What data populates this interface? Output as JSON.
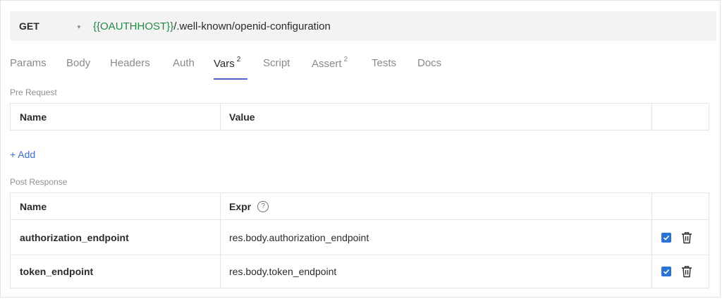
{
  "request": {
    "method": "GET",
    "url_var": "{{OAUTHHOST}}",
    "url_path": "/.well-known/openid-configuration"
  },
  "tabs": [
    {
      "label": "Params",
      "sup": ""
    },
    {
      "label": "Body",
      "sup": ""
    },
    {
      "label": "Headers",
      "sup": ""
    },
    {
      "label": "Auth",
      "sup": ""
    },
    {
      "label": "Vars",
      "sup": "2"
    },
    {
      "label": "Script",
      "sup": ""
    },
    {
      "label": "Assert",
      "sup": "2"
    },
    {
      "label": "Tests",
      "sup": ""
    },
    {
      "label": "Docs",
      "sup": ""
    }
  ],
  "active_tab": "Vars",
  "pre_request": {
    "label": "Pre Request",
    "headers": {
      "name": "Name",
      "value": "Value"
    },
    "add_label": "+ Add"
  },
  "post_response": {
    "label": "Post Response",
    "headers": {
      "name": "Name",
      "expr": "Expr"
    },
    "rows": [
      {
        "name": "authorization_endpoint",
        "expr": "res.body.authorization_endpoint",
        "enabled": true
      },
      {
        "name": "token_endpoint",
        "expr": "res.body.token_endpoint",
        "enabled": true
      }
    ]
  },
  "colors": {
    "accent": "#5561d8",
    "variable": "#1f8a47",
    "link": "#3f6bd8",
    "checkbox": "#2a72d8"
  }
}
